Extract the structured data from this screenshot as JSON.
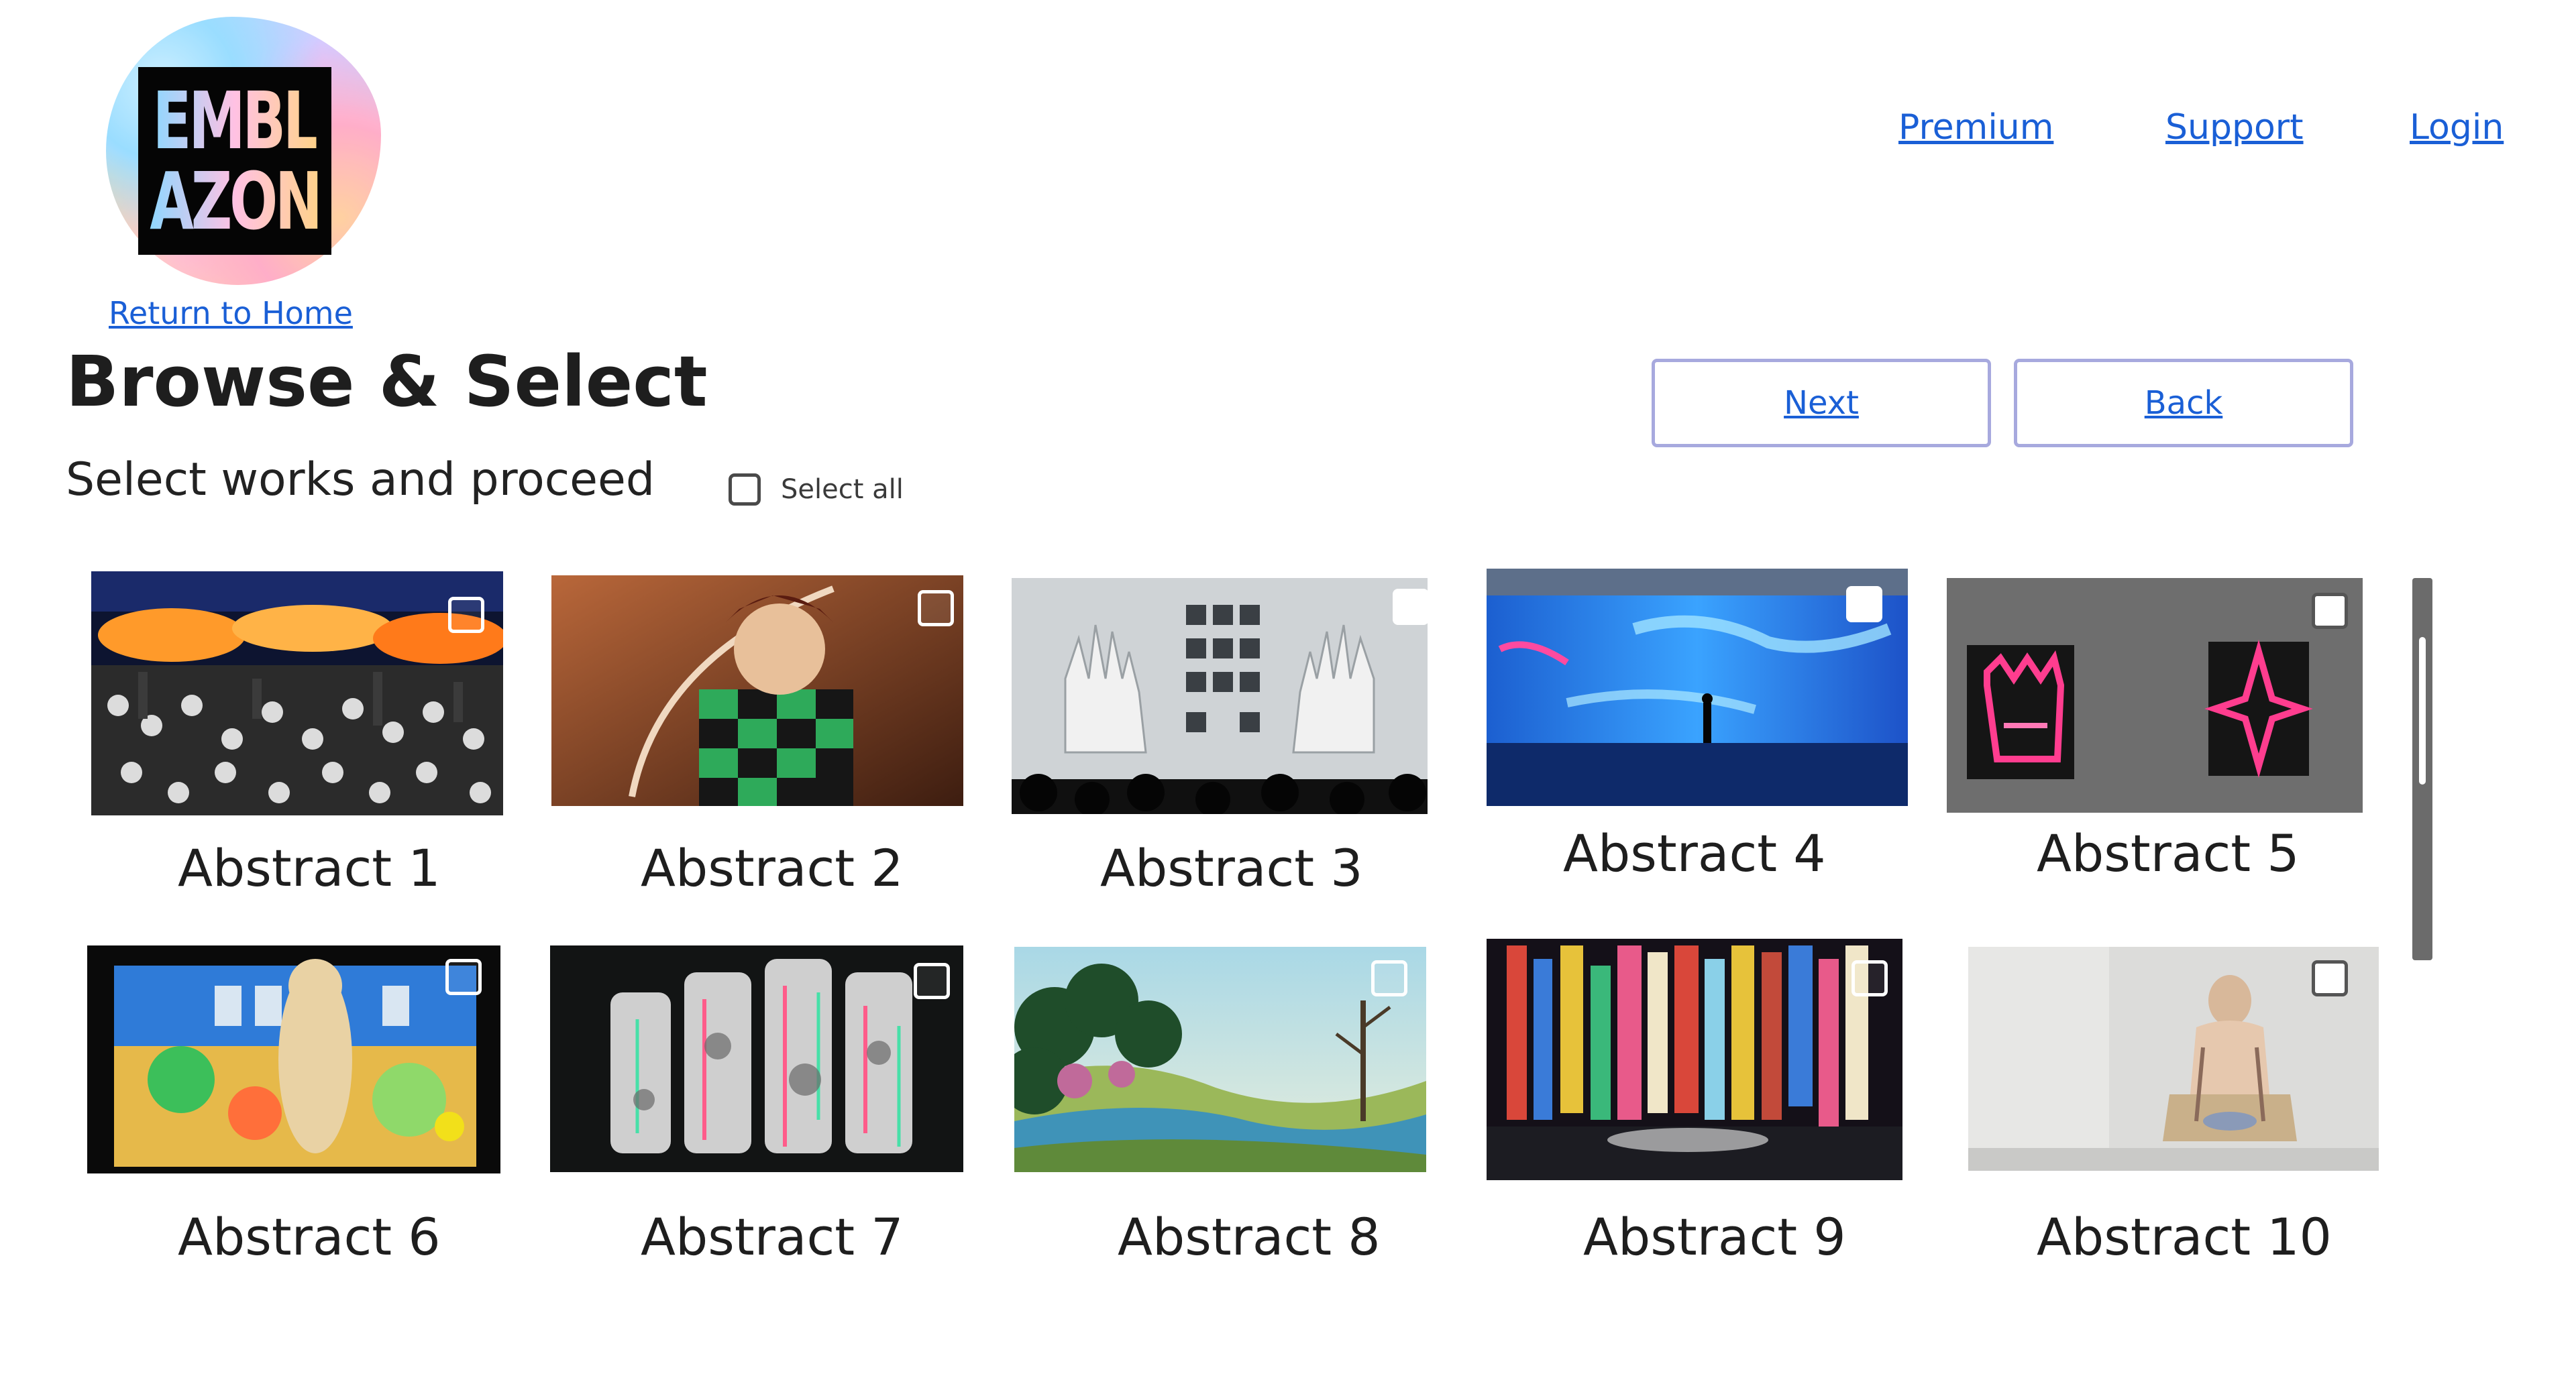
{
  "brand": {
    "logo_line1": "EMBL",
    "logo_line2": "AZON",
    "return_home": "Return to Home"
  },
  "nav": {
    "premium": "Premium",
    "support": "Support",
    "login": "Login"
  },
  "heading": {
    "title": "Browse & Select",
    "subtitle": "Select works and proceed"
  },
  "select_all": {
    "label": "Select all",
    "checked": false
  },
  "buttons": {
    "next": "Next",
    "back": "Back"
  },
  "colors": {
    "link": "#1a5fd6",
    "button_border": "#a7a9de",
    "scrollbar": "#6b6b6b"
  },
  "works": [
    {
      "title": "Abstract 1",
      "checked": false
    },
    {
      "title": "Abstract 2",
      "checked": false
    },
    {
      "title": "Abstract 3",
      "checked": false
    },
    {
      "title": "Abstract 4",
      "checked": false
    },
    {
      "title": "Abstract 5",
      "checked": false
    },
    {
      "title": "Abstract 6",
      "checked": false
    },
    {
      "title": "Abstract 7",
      "checked": false
    },
    {
      "title": "Abstract 8",
      "checked": false
    },
    {
      "title": "Abstract 9",
      "checked": false
    },
    {
      "title": "Abstract 10",
      "checked": false
    }
  ]
}
